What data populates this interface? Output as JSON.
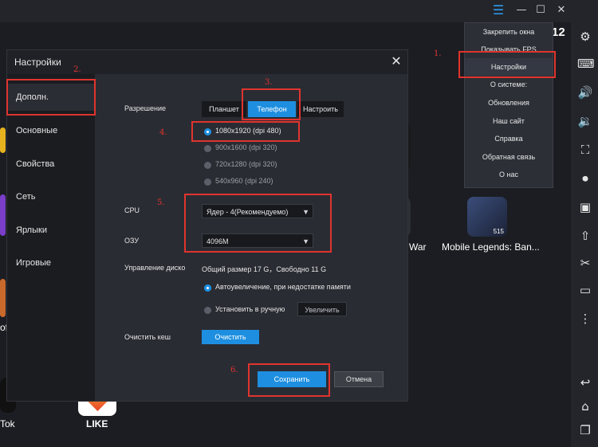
{
  "window": {
    "time": "12",
    "controls": [
      "menu-icon",
      "minimize-icon",
      "maximize-icon",
      "close-icon"
    ]
  },
  "dropdown_menu": {
    "items": [
      {
        "label": "Закрепить окна"
      },
      {
        "label": "Показывать FPS"
      },
      {
        "label": "Настройки"
      },
      {
        "label": "О системе:"
      },
      {
        "label": "Обновления"
      },
      {
        "label": "Наш сайт"
      },
      {
        "label": "Справка"
      },
      {
        "label": "Обратная связь"
      },
      {
        "label": "О нас"
      }
    ]
  },
  "apps": {
    "items": [
      {
        "label": "War"
      },
      {
        "label": "Mobile Legends: Ban..."
      },
      {
        "label": "Tok"
      },
      {
        "label": "LIKE"
      },
      {
        "label": "of"
      }
    ],
    "mobile_legends_badge": "515"
  },
  "dialog": {
    "title": "Настройки",
    "sidebar": [
      {
        "label": "Дополн."
      },
      {
        "label": "Основные"
      },
      {
        "label": "Свойства"
      },
      {
        "label": "Сеть"
      },
      {
        "label": "Ярлыки"
      },
      {
        "label": "Игровые"
      }
    ],
    "resolution": {
      "label": "Разрешение",
      "modes": [
        "Планшет",
        "Телефон",
        "Настроить"
      ],
      "options": [
        "1080x1920  (dpi 480)",
        "900x1600  (dpi 320)",
        "720x1280  (dpi 320)",
        "540x960  (dpi 240)"
      ]
    },
    "cpu": {
      "label": "CPU",
      "value": "Ядер - 4(Рекомендуемо)"
    },
    "ram": {
      "label": "ОЗУ",
      "value": "4096M"
    },
    "disk": {
      "label": "Управление диско",
      "info": "Общий размер 17 G，Свободно 11 G",
      "auto": "Автоувеличение, при недостатке памяти",
      "manual": "Установить в ручную",
      "increase": "Увеличить"
    },
    "cache": {
      "label": "Очистить кеш",
      "button": "Очистить"
    },
    "save": "Сохранить",
    "cancel": "Отмена"
  },
  "annotations": [
    "1.",
    "2.",
    "3.",
    "4.",
    "5.",
    "6."
  ],
  "colors": {
    "accent": "#1e8fe0",
    "annotation": "#e0342e",
    "background": "#1b1d22"
  }
}
